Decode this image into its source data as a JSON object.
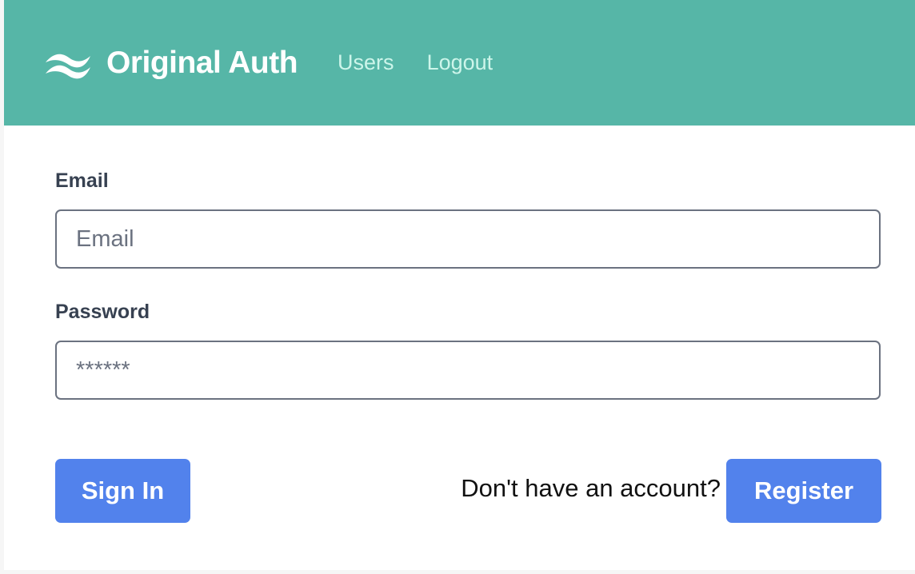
{
  "navbar": {
    "brand_icon": "waves-icon",
    "brand_name": "Original Auth",
    "links": [
      {
        "label": "Users"
      },
      {
        "label": "Logout"
      }
    ]
  },
  "form": {
    "email": {
      "label": "Email",
      "placeholder": "Email",
      "value": ""
    },
    "password": {
      "label": "Password",
      "placeholder": "******",
      "value": ""
    },
    "sign_in_label": "Sign In",
    "account_prompt": "Don't have an account?",
    "register_label": "Register"
  },
  "colors": {
    "navbar_bg": "#56b6a7",
    "nav_link": "#cdf5ea",
    "button_bg": "#5282ec",
    "label_text": "#374151",
    "input_border": "#6b7280"
  }
}
